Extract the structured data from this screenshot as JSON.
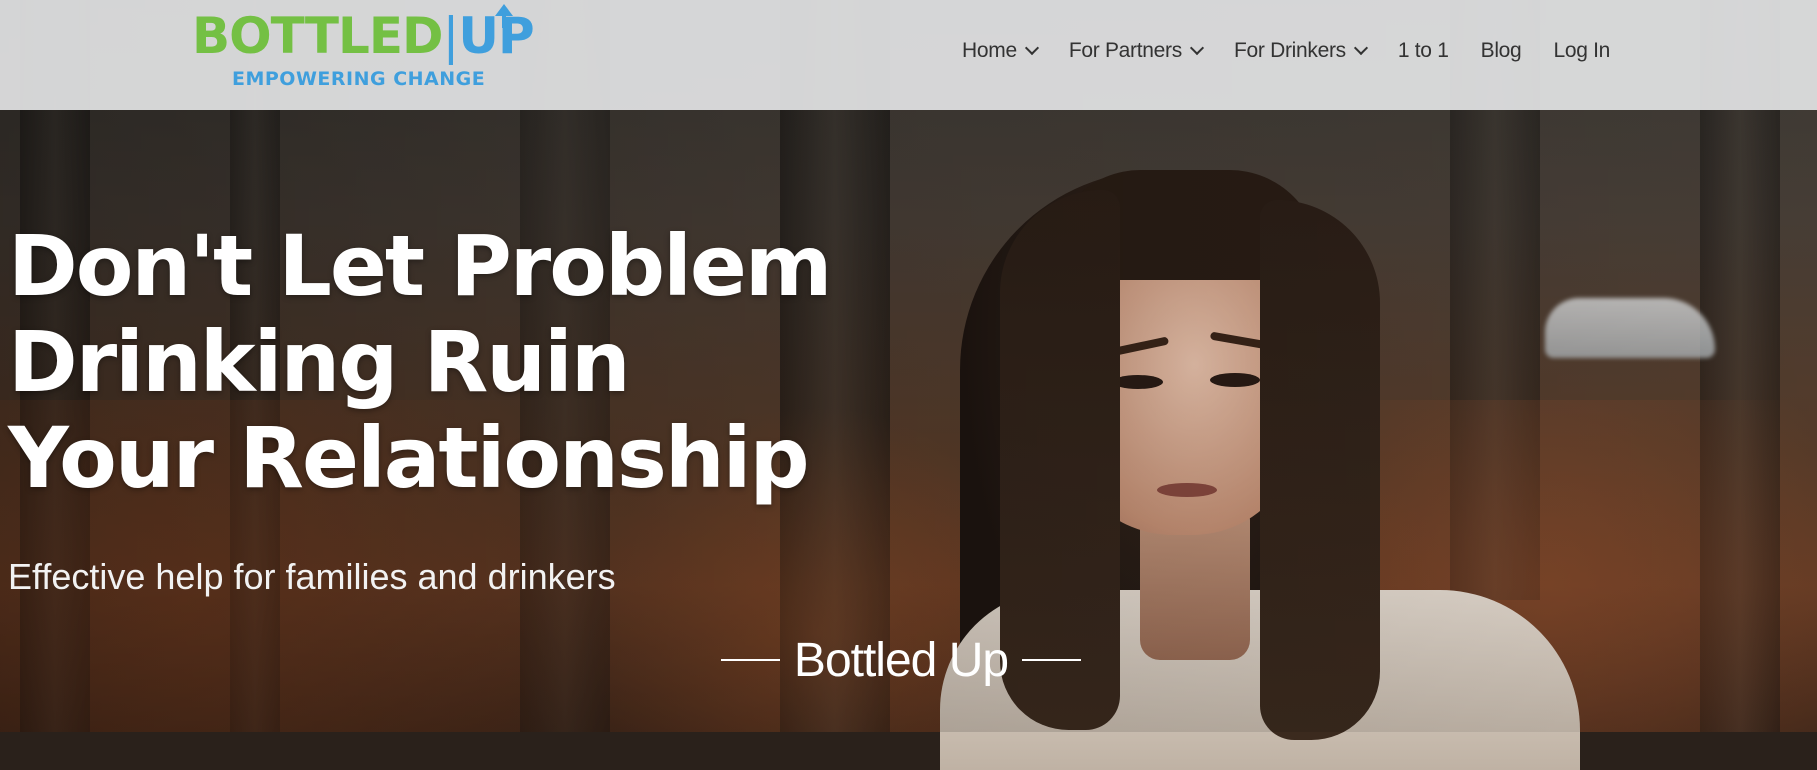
{
  "logo": {
    "wordmark_left": "BOTTLED",
    "wordmark_right": "UP",
    "tagline": "EMPOWERING CHANGE"
  },
  "nav": {
    "items": [
      {
        "label": "Home",
        "has_dropdown": true
      },
      {
        "label": "For Partners",
        "has_dropdown": true
      },
      {
        "label": "For Drinkers",
        "has_dropdown": true
      },
      {
        "label": "1 to 1",
        "has_dropdown": false
      },
      {
        "label": "Blog",
        "has_dropdown": false
      },
      {
        "label": "Log In",
        "has_dropdown": false
      }
    ]
  },
  "hero": {
    "headline_lines": [
      "Don't Let Problem",
      "Drinking Ruin",
      "Your Relationship"
    ],
    "subheadline": "Effective help for families and drinkers",
    "brand_caption": "Bottled Up"
  },
  "colors": {
    "logo_green": "#74c044",
    "logo_blue": "#3f9fdd",
    "header_bg": "#e2e3e4",
    "nav_text": "#333333",
    "hero_text": "#ffffff"
  }
}
